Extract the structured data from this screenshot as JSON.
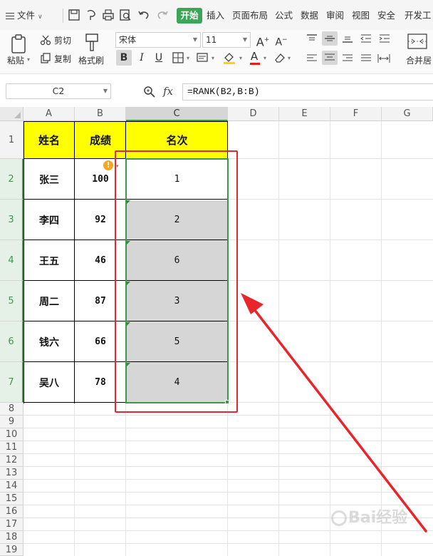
{
  "menubar": {
    "file_label": "文件",
    "tabs": [
      {
        "label": "开始",
        "active": true
      },
      {
        "label": "插入"
      },
      {
        "label": "页面布局"
      },
      {
        "label": "公式"
      },
      {
        "label": "数据"
      },
      {
        "label": "审阅"
      },
      {
        "label": "视图"
      },
      {
        "label": "安全"
      },
      {
        "label": "开发工"
      }
    ]
  },
  "ribbon": {
    "paste_label": "粘贴",
    "cut_label": "剪切",
    "copy_label": "复制",
    "format_painter_label": "格式刷",
    "font_name": "宋体",
    "font_size": "11",
    "merge_center_label": "合并居"
  },
  "formula_bar": {
    "cell_ref": "C2",
    "fx_label": "fx",
    "formula": "=RANK(B2,B:B)"
  },
  "sheet": {
    "columns": [
      "A",
      "B",
      "C",
      "D",
      "E",
      "F",
      "G"
    ],
    "rows": [
      "1",
      "2",
      "3",
      "4",
      "5",
      "6",
      "7",
      "8",
      "9",
      "10",
      "11",
      "12",
      "13",
      "14",
      "15",
      "16",
      "17",
      "18",
      "19"
    ],
    "selected_column": "C",
    "selected_rows": [
      "2",
      "3",
      "4",
      "5",
      "6",
      "7"
    ],
    "headers": {
      "name": "姓名",
      "score": "成绩",
      "rank": "名次"
    },
    "records": [
      {
        "name": "张三",
        "score": "100",
        "rank": "1"
      },
      {
        "name": "李四",
        "score": "92",
        "rank": "2"
      },
      {
        "name": "王五",
        "score": "46",
        "rank": "6"
      },
      {
        "name": "周二",
        "score": "87",
        "rank": "3"
      },
      {
        "name": "钱六",
        "score": "66",
        "rank": "5"
      },
      {
        "name": "吴八",
        "score": "78",
        "rank": "4"
      }
    ],
    "header_fill": "#ffff00",
    "selection_color": "#3a9a4a",
    "annotation_color": "#e8252a"
  },
  "watermark": "Bai经验"
}
